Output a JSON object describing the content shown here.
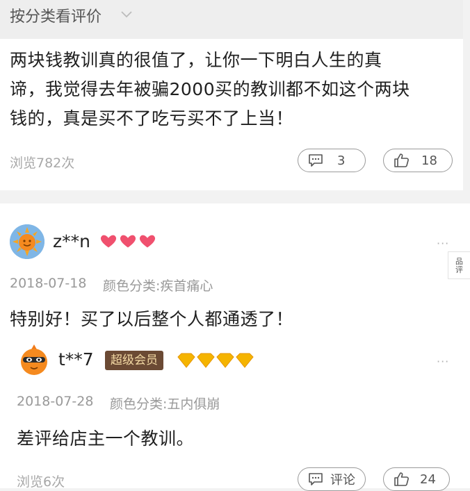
{
  "filter": {
    "label": "按分类看评价",
    "icon": "chevron-down-icon"
  },
  "reviews": [
    {
      "text": "两块钱教训真的很值了，让你一下明白人生的真谛，我觉得去年被骗2000买的教训都不如这个两块钱的，真是买不了吃亏买不了上当！",
      "text_lines": [
        "两块钱教训真的很值了，让你一下明白人生的真",
        "谛，我觉得去年被骗2000买的教训都不如这个两块",
        "钱的，真是买不了吃亏买不了上当！"
      ],
      "views": "浏览782次",
      "comment_count": "3",
      "like_count": "18"
    },
    {
      "username": "z**n",
      "level": "3 red hearts",
      "date": "2018-07-18",
      "variant": "颜色分类:疾首痛心",
      "text": "特别好！买了以后整个人都通透了！"
    },
    {
      "username": "t**7",
      "badge": "超级会员",
      "level": "4 gold diamonds",
      "date": "2018-07-28",
      "variant": "颜色分类:五内俱崩",
      "text": "差评给店主一个教训。",
      "views": "浏览6次",
      "comment_label": "评论",
      "like_count": "24"
    }
  ],
  "side_button": {
    "label": "品\n评"
  },
  "more_label": "···",
  "colors": {
    "accent_red": "#f0506e",
    "gold": "#f5b400",
    "badge_bg": "#6b4a34"
  }
}
